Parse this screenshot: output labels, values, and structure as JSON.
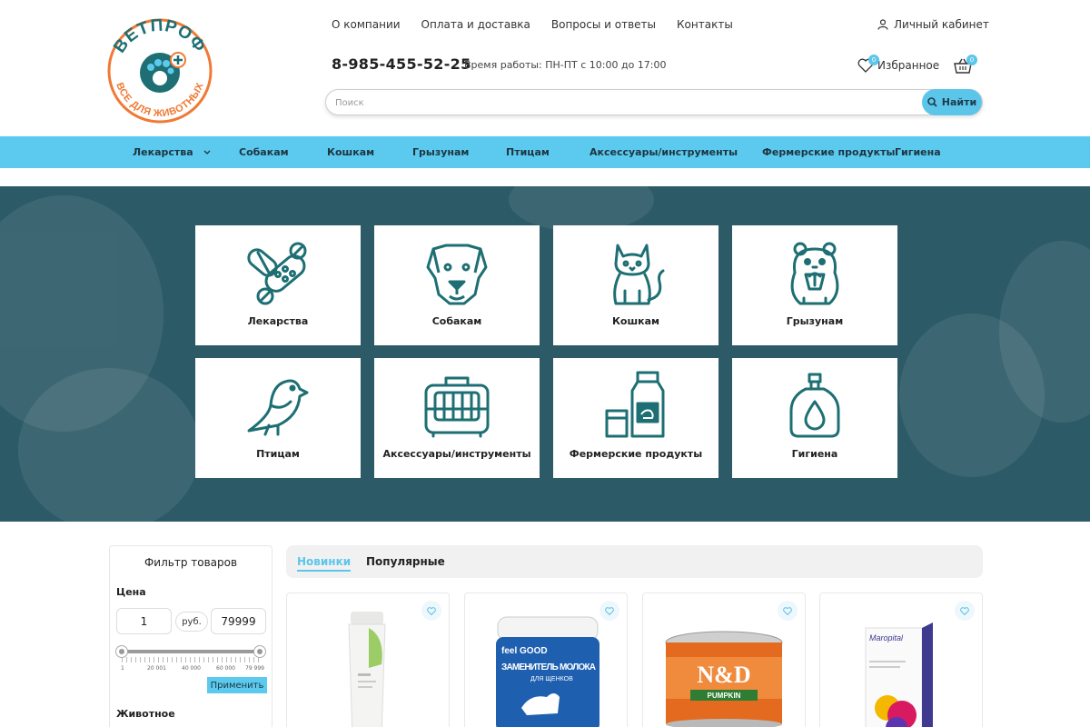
{
  "header": {
    "logo_text_top": "ВЕТПРОФ",
    "logo_text_bottom": "ВСЕ ДЛЯ ЖИВОТНЫХ",
    "nav": [
      "О компании",
      "Оплата и доставка",
      "Вопросы и ответы",
      "Контакты"
    ],
    "account_label": "Личный кабинет",
    "phone": "8-985-455-52-25",
    "hours": "Время работы: ПН-ПТ с 10:00 до 17:00",
    "favorites_label": "Избранное",
    "favorites_count": "0",
    "cart_count": "0",
    "search_placeholder": "Поиск",
    "search_button": "Найти"
  },
  "catbar": [
    "Лекарства",
    "Собакам",
    "Кошкам",
    "Грызунам",
    "Птицам",
    "Аксессуары/инструменты",
    "Фермерские продукты",
    "Гигиена"
  ],
  "tiles": [
    {
      "label": "Лекарства",
      "icon": "pills-icon"
    },
    {
      "label": "Собакам",
      "icon": "dog-icon"
    },
    {
      "label": "Кошкам",
      "icon": "cat-icon"
    },
    {
      "label": "Грызунам",
      "icon": "hamster-icon"
    },
    {
      "label": "Птицам",
      "icon": "bird-icon"
    },
    {
      "label": "Аксессуары/инструменты",
      "icon": "carrier-icon"
    },
    {
      "label": "Фермерские продукты",
      "icon": "milk-icon"
    },
    {
      "label": "Гигиена",
      "icon": "soap-icon"
    }
  ],
  "filter": {
    "title": "Фильтр товаров",
    "price_label": "Цена",
    "price_min": "1",
    "currency": "руб.",
    "price_max": "79999",
    "slider_min_fraction": 0,
    "slider_max_fraction": 1,
    "tick_labels": [
      "1",
      "20 001",
      "40 000",
      "60 000",
      "79 999"
    ],
    "apply": "Применить",
    "animal_label": "Животное"
  },
  "tabs": {
    "new": "Новинки",
    "popular": "Популярные"
  },
  "products": [
    {
      "name": "tube",
      "pkg_text_1": "",
      "pkg_text_2": ""
    },
    {
      "name": "milk-replacer",
      "pkg_text_1": "feel GOOD",
      "pkg_text_2": "ЗАМЕНИТЕЛЬ МОЛОКА",
      "pkg_text_3": "ДЛЯ ЩЕНКОВ"
    },
    {
      "name": "nd-can",
      "pkg_text_1": "N&D",
      "pkg_text_2": "PUMPKIN"
    },
    {
      "name": "maropital-box",
      "pkg_text_1": "Maropital"
    }
  ],
  "colors": {
    "accent": "#5ccaef",
    "hero_bg": "#2c5b67",
    "icon_stroke": "#1d6f73",
    "logo_orange": "#f07a35",
    "logo_teal": "#1d6f73"
  }
}
